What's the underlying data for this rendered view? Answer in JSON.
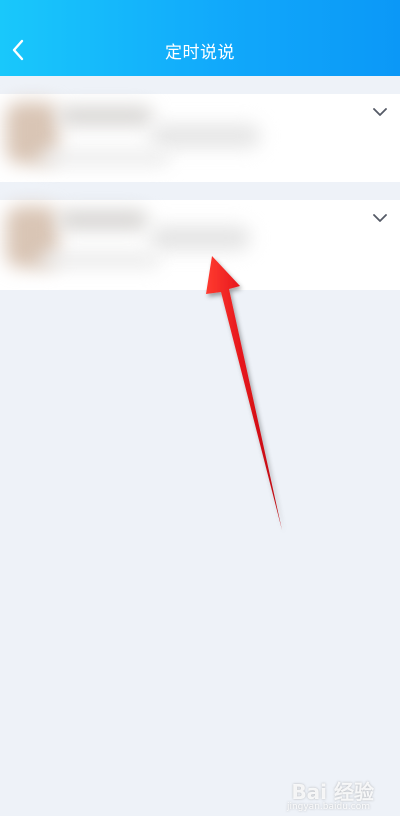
{
  "header": {
    "title": "定时说说",
    "back_icon": "chevron-left-icon"
  },
  "colors": {
    "header_gradient_start": "#19c8fb",
    "header_gradient_end": "#0b98f7",
    "page_background": "#eef2f8",
    "annotation_arrow": "#e4141b"
  },
  "posts": [
    {
      "content": "",
      "expand_icon": "chevron-down-icon"
    },
    {
      "content": "",
      "expand_icon": "chevron-down-icon"
    }
  ],
  "watermark": {
    "brand": "Bai 经验",
    "url": "jingyan.baidu.com"
  }
}
